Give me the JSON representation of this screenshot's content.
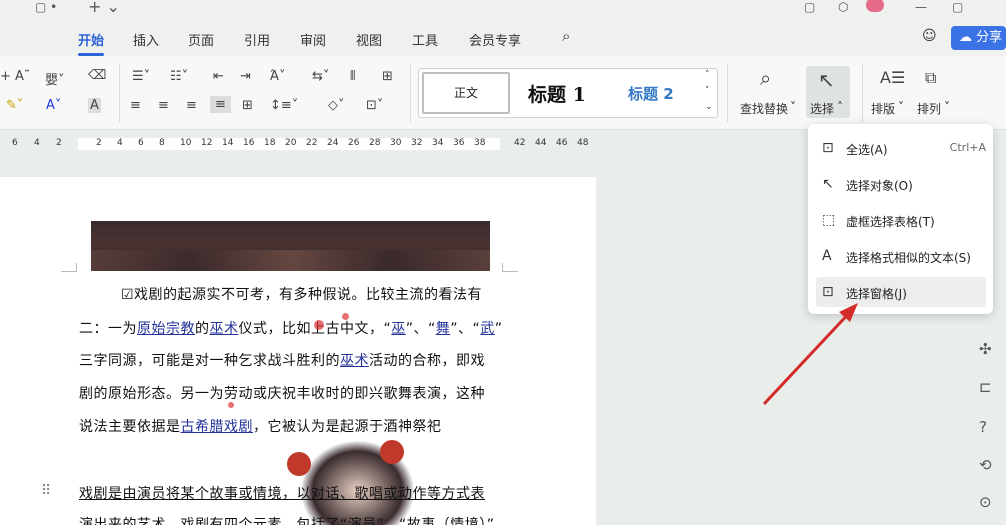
{
  "tabs": [
    {
      "label": "开始",
      "active": true
    },
    {
      "label": "插入"
    },
    {
      "label": "页面"
    },
    {
      "label": "引用"
    },
    {
      "label": "审阅"
    },
    {
      "label": "视图"
    },
    {
      "label": "工具"
    },
    {
      "label": "会员专享"
    }
  ],
  "share_label": "分享",
  "styles": {
    "normal": "正文",
    "h1": "标题 1",
    "h2": "标题 2"
  },
  "ribbon_labels": {
    "find_replace": "查找替换",
    "select": "选择",
    "layout": "排版",
    "arrange": "排列"
  },
  "ruler_ticks": [
    "6",
    "4",
    "2",
    "2",
    "4",
    "6",
    "8",
    "10",
    "12",
    "14",
    "16",
    "18",
    "20",
    "22",
    "24",
    "26",
    "28",
    "30",
    "32",
    "34",
    "36",
    "38",
    "42",
    "44",
    "46",
    "48"
  ],
  "doc": {
    "line1": "☑戏剧的起源实不可考，有多种假说。比较主流的看法有",
    "line2_a": "二：一为",
    "line2_link1": "原始宗教",
    "line2_b": "的",
    "line2_link2": "巫术",
    "line2_c": "仪式，比如上古中文，“",
    "line2_q1": "巫",
    "line2_sep1": "”、“",
    "line2_q2": "舞",
    "line2_sep2": "”、“",
    "line2_q3": "武",
    "line2_end": "”",
    "line3_a": "三字同源，可能是对一种乞求战斗胜利的",
    "line3_link": "巫术",
    "line3_b": "活动的合称，即戏",
    "line4": "剧的原始形态。另一为劳动或庆祝丰收时的即兴歌舞表演，这种",
    "line5_a": "说法主要依据是",
    "line5_link": "古希腊戏剧",
    "line5_b": "，它被认为是起源于酒神祭祀",
    "line6": "戏剧是由演员将某个故事或情境，以对话、歌唱或动作等方式表",
    "line7": "演出来的艺术。戏剧有四个元素，包括了“演员”、“故事（情境）”"
  },
  "menu": {
    "items": [
      {
        "label": "全选(A)",
        "shortcut": "Ctrl+A",
        "icon": "select-all-icon"
      },
      {
        "label": "选择对象(O)",
        "icon": "cursor-arrow-icon"
      },
      {
        "label": "虚框选择表格(T)",
        "icon": "dashed-box-icon"
      },
      {
        "label": "选择格式相似的文本(S)",
        "icon": "similar-text-icon"
      },
      {
        "label": "选择窗格(J)",
        "icon": "selection-pane-icon",
        "highlighted": true
      }
    ]
  },
  "colors": {
    "accent": "#2e62d9",
    "share": "#3b73e6",
    "arrow": "#d42a2a",
    "link": "#23339a"
  }
}
